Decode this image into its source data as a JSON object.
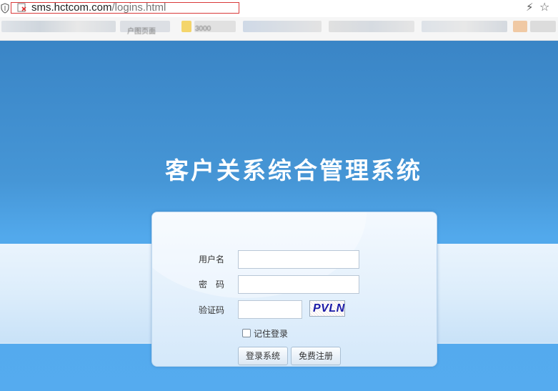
{
  "browser": {
    "url_host": "sms.hctcom.com",
    "url_path": "/logins.html",
    "bookmarks": [
      "户图页面",
      "3000"
    ]
  },
  "page": {
    "title": "客户关系综合管理系统"
  },
  "login": {
    "username_label": "用户名",
    "username_value": "",
    "password_label": "密　码",
    "password_value": "",
    "captcha_label": "验证码",
    "captcha_value": "",
    "captcha_image_text": "PVLN",
    "remember_label": "记住登录",
    "remember_checked": false,
    "login_button": "登录系统",
    "register_button": "免费注册"
  },
  "colors": {
    "background_top": "#3a85c6",
    "background_bottom": "#55abef",
    "title": "#ffffff",
    "url_highlight_border": "#d93a3a"
  }
}
